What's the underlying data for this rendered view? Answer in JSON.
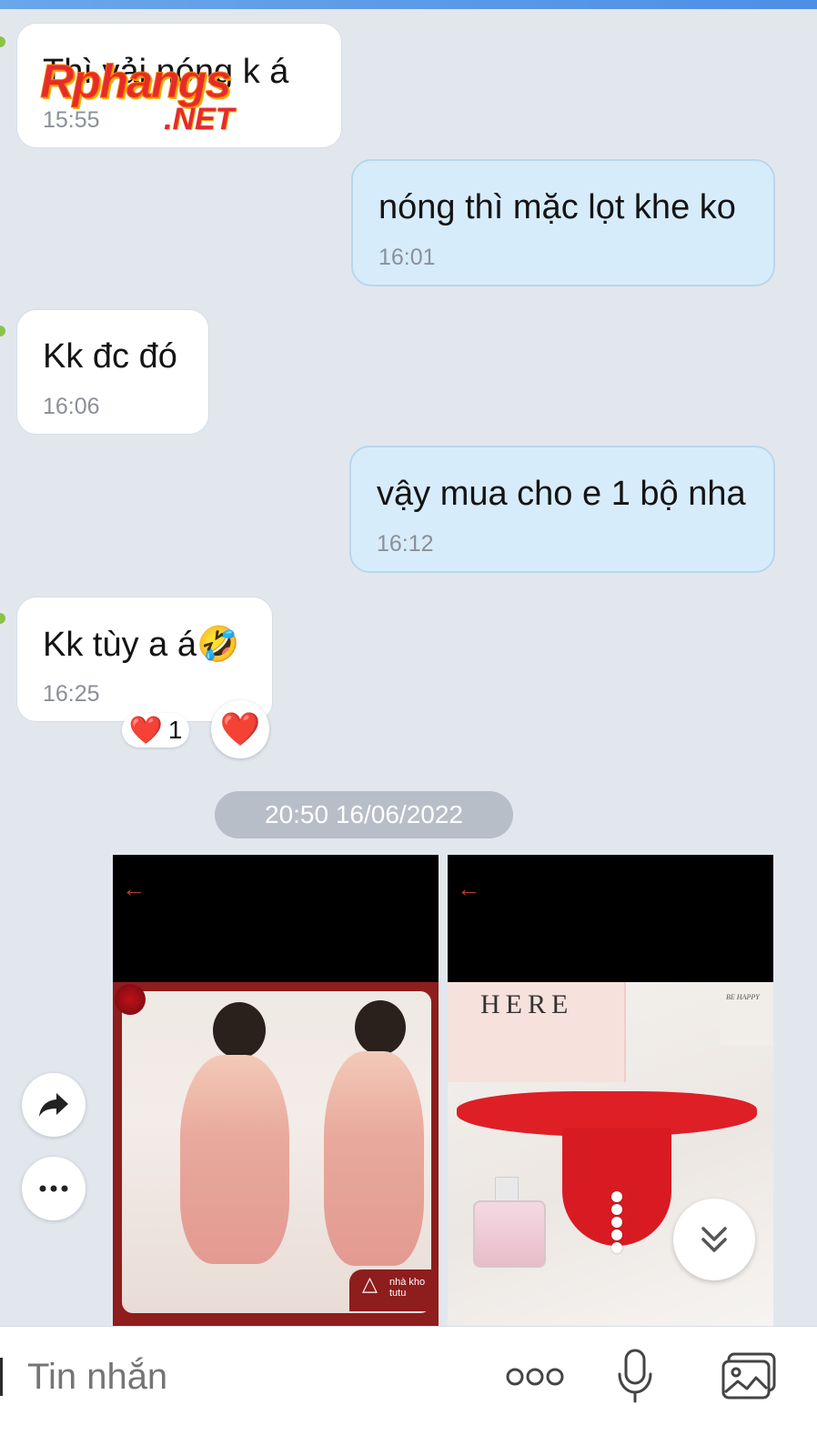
{
  "messages": [
    {
      "dir": "in",
      "text": "Thì vải nóng k á",
      "time": "15:55"
    },
    {
      "dir": "out",
      "text": "nóng thì mặc lọt khe ko",
      "time": "16:01"
    },
    {
      "dir": "in",
      "text": "Kk đc đó",
      "time": "16:06"
    },
    {
      "dir": "out",
      "text": "vậy mua cho e 1 bộ nha",
      "time": "16:12"
    },
    {
      "dir": "in",
      "text": "Kk tùy a á🤣",
      "time": "16:25"
    }
  ],
  "reaction": {
    "emoji": "❤️",
    "count": "1",
    "button_emoji": "❤️"
  },
  "date_divider": "20:50 16/06/2022",
  "watermark": {
    "main": "Rphangs",
    "net": ".NET"
  },
  "photos": [
    {
      "name": "photo-pink-lingerie",
      "brand_line1": "nhà kho",
      "brand_line2": "tutu"
    },
    {
      "name": "photo-red-lace",
      "card_text": "HERE",
      "card2_text": "BE HAPPY"
    }
  ],
  "composer": {
    "placeholder": "Tin nhắn"
  },
  "icons": {
    "forward": "forward-arrow-icon",
    "more": "more-dots-icon",
    "scroll_down": "double-chevron-down-icon",
    "emoji": "ooo-sticker-icon",
    "mic": "microphone-icon",
    "image": "image-gallery-icon"
  },
  "colors": {
    "background": "#e2e7ee",
    "bubble_in": "#ffffff",
    "bubble_out": "#d7ecfb",
    "accent": "#4c8fe6",
    "heart": "#e0182c"
  }
}
